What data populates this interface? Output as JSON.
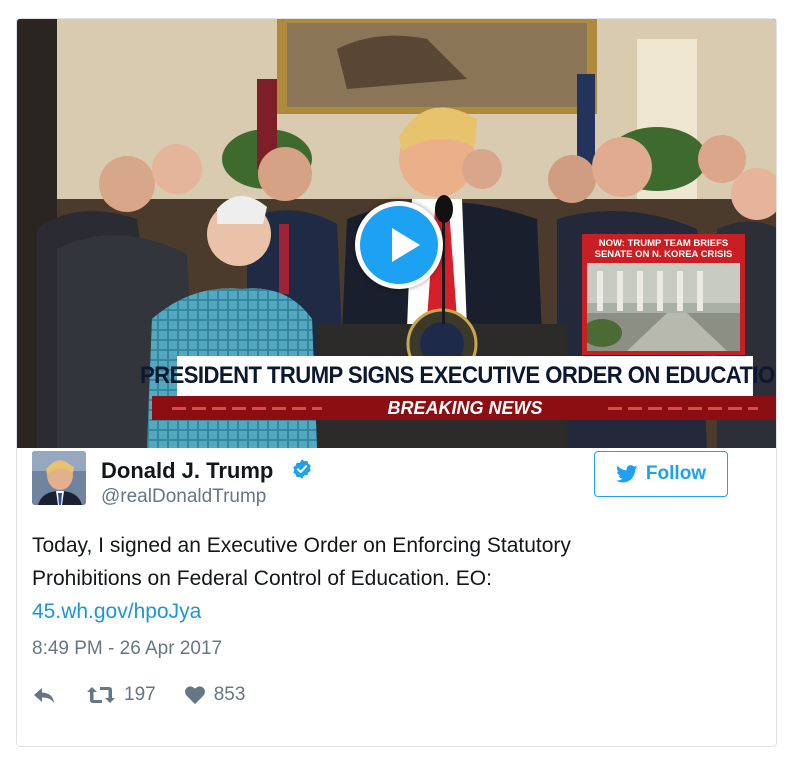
{
  "video": {
    "chyron_headline": "PRESIDENT TRUMP SIGNS EXECUTIVE ORDER ON EDUCATION",
    "chyron_sub": "BREAKING NEWS",
    "inset_line1": "NOW: TRUMP TEAM BRIEFS",
    "inset_line2": "SENATE ON N. KOREA CRISIS",
    "play_icon": "play-icon"
  },
  "author": {
    "name": "Donald J. Trump",
    "handle": "@realDonaldTrump",
    "verified_icon": "verified-badge-icon"
  },
  "follow": {
    "label": "Follow",
    "icon": "twitter-bird-icon"
  },
  "tweet": {
    "line1": "Today, I signed an Executive Order on Enforcing Statutory",
    "line2": "Prohibitions on Federal Control of Education. EO:",
    "link": "45.wh.gov/hpoJya",
    "timestamp": "8:49 PM - 26 Apr 2017"
  },
  "stats": {
    "retweets": "197",
    "likes": "853"
  },
  "colors": {
    "accent": "#1da1f2",
    "link": "#1b95e0",
    "muted": "#657786",
    "text": "#14171a"
  }
}
